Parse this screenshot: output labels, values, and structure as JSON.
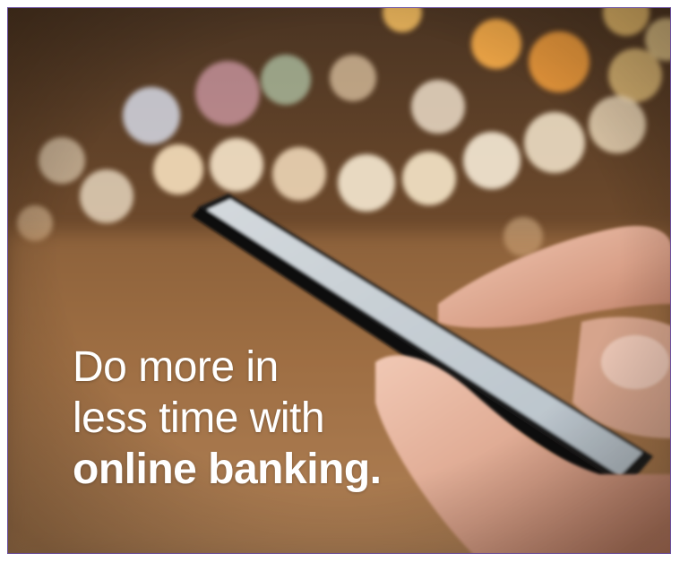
{
  "ad": {
    "headline": {
      "line1": "Do more in",
      "line2": "less time with",
      "line3": "online banking."
    },
    "photo": {
      "subject": "hand-holding-smartphone-icon",
      "colors": {
        "frame_border": "#6a4fa0",
        "text": "#ffffff",
        "bokeh_warm": "#ffd48a",
        "bokeh_cool": "#d9e6ff"
      }
    }
  }
}
